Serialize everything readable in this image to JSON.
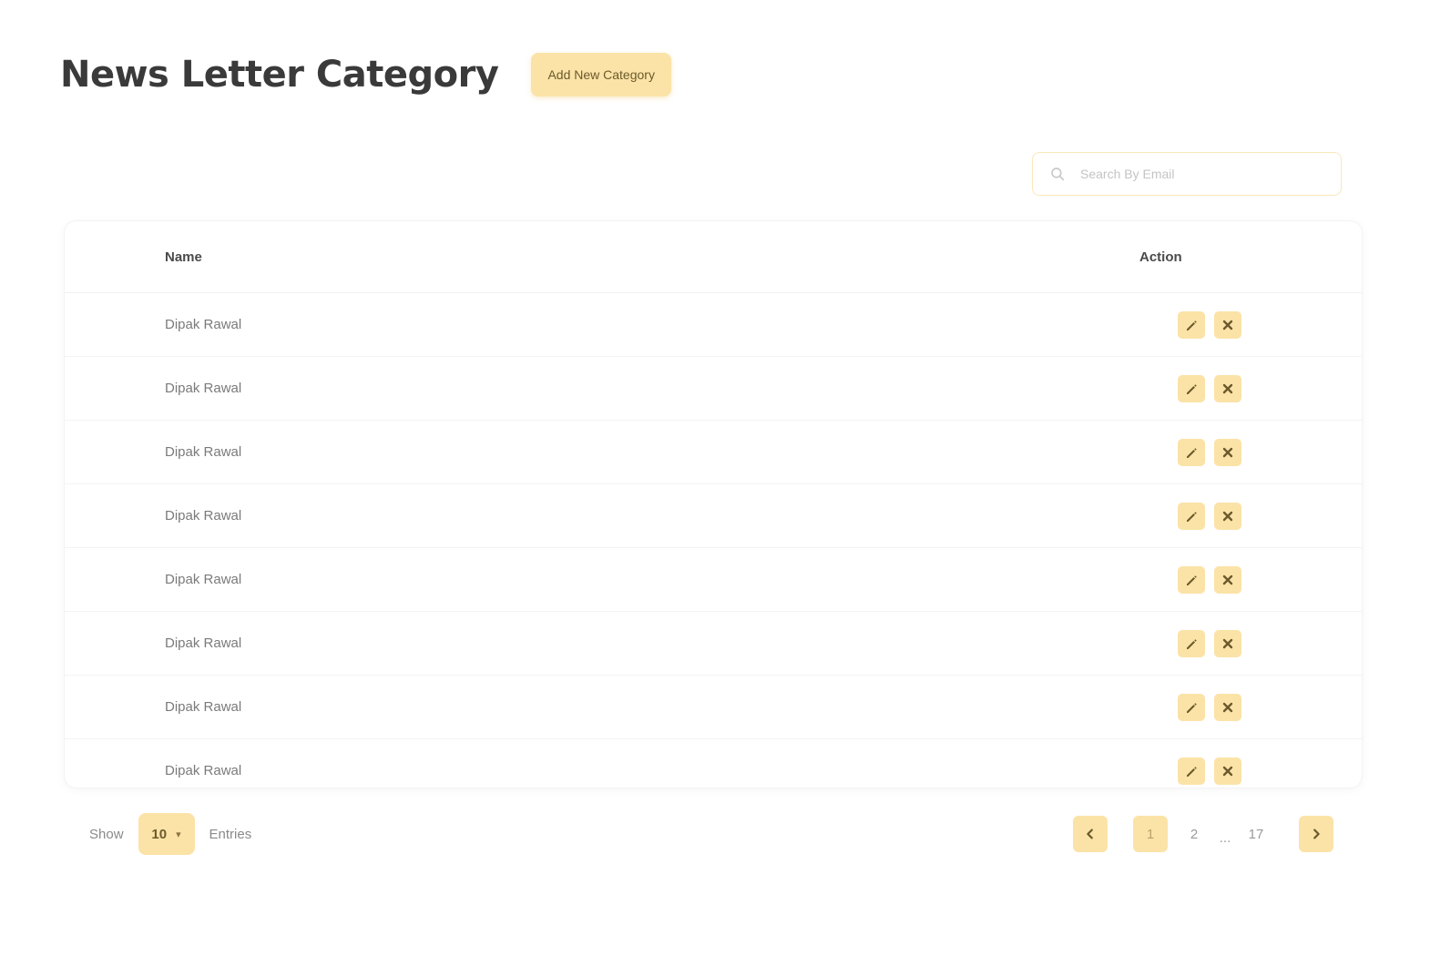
{
  "header": {
    "title": "News Letter Category",
    "add_button_label": "Add New Category"
  },
  "search": {
    "placeholder": "Search By Email",
    "value": ""
  },
  "table": {
    "columns": [
      "Name",
      "Action"
    ],
    "rows": [
      {
        "name": "Dipak Rawal"
      },
      {
        "name": "Dipak Rawal"
      },
      {
        "name": "Dipak Rawal"
      },
      {
        "name": "Dipak Rawal"
      },
      {
        "name": "Dipak Rawal"
      },
      {
        "name": "Dipak Rawal"
      },
      {
        "name": "Dipak Rawal"
      },
      {
        "name": "Dipak Rawal"
      }
    ],
    "row_actions": [
      "edit-icon",
      "close-icon"
    ]
  },
  "footer": {
    "show_label": "Show",
    "entries_value": "10",
    "entries_label": "Entries"
  },
  "pagination": {
    "prev_icon": "chevron-left-icon",
    "pages": [
      "1",
      "2"
    ],
    "active_page": "1",
    "ellipsis": "...",
    "last_page": "17",
    "next_icon": "chevron-right-icon"
  },
  "colors": {
    "accent": "#fbe3a7",
    "accent_text": "#6b5a2c",
    "title": "#3a3a3a"
  }
}
